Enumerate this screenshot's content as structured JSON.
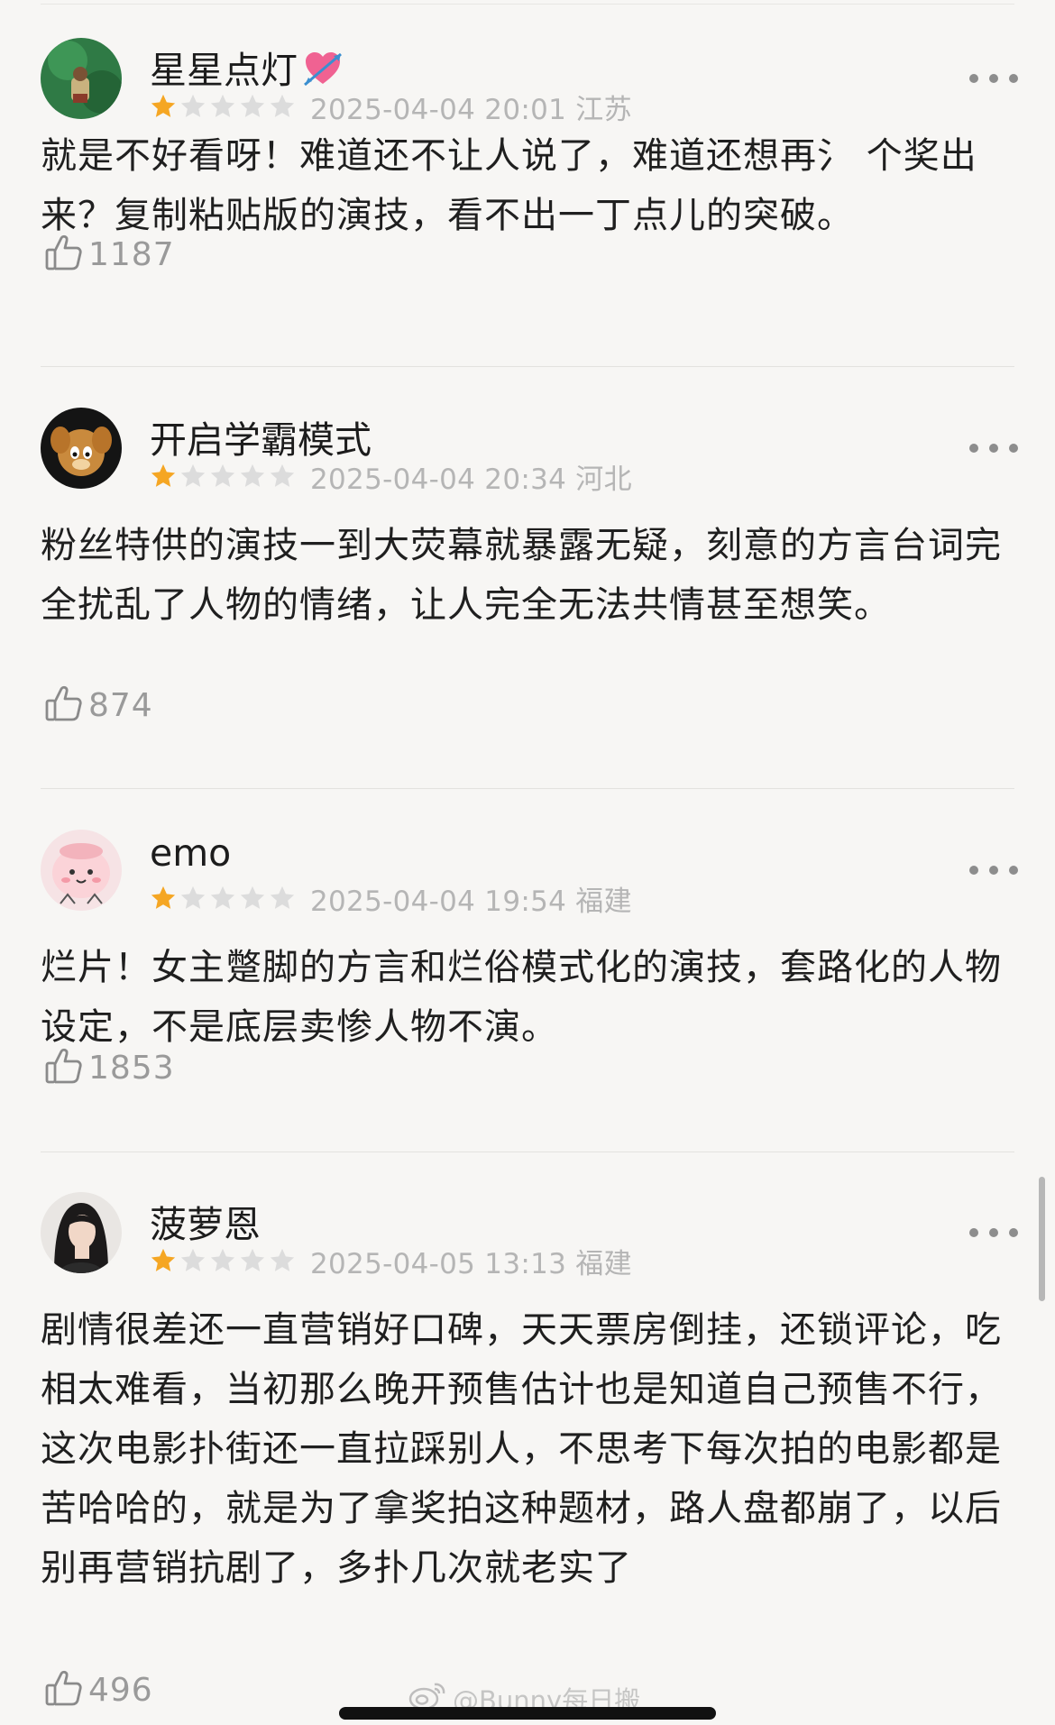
{
  "comments": [
    {
      "username": "星星点灯",
      "has_emoji": true,
      "emoji_name": "heart-with-arrow",
      "rating": 1,
      "max_rating": 5,
      "meta": "2025-04-04 20:01 江苏",
      "text": "就是不好看呀！难道还不让人说了，难道还想再氵 个奖出来？复制粘贴版的演技，看不出一丁点儿的突破。",
      "likes": "1187"
    },
    {
      "username": "开启学霸模式",
      "rating": 1,
      "max_rating": 5,
      "meta": "2025-04-04 20:34 河北",
      "text": "粉丝特供的演技一到大荧幕就暴露无疑，刻意的方言台词完全扰乱了人物的情绪，让人完全无法共情甚至想笑。",
      "likes": "874"
    },
    {
      "username": "emo",
      "rating": 1,
      "max_rating": 5,
      "meta": "2025-04-04 19:54 福建",
      "text": "烂片！女主蹩脚的方言和烂俗模式化的演技，套路化的人物设定，不是底层卖惨人物不演。",
      "likes": "1853"
    },
    {
      "username": "菠萝恩",
      "rating": 1,
      "max_rating": 5,
      "meta": "2025-04-05 13:13 福建",
      "text": "剧情很差还一直营销好口碑，天天票房倒挂，还锁评论，吃相太难看，当初那么晚开预售估计也是知道自己预售不行，这次电影扑街还一直拉踩别人，不思考下每次拍的电影都是苦哈哈的，就是为了拿奖拍这种题材，路人盘都崩了，以后别再营销抗剧了，多扑几次就老实了",
      "likes": "496"
    }
  ],
  "watermark": "@Bunny每日搬",
  "colors": {
    "background": "#f7f6f4",
    "star_filled": "#f5a623",
    "star_empty": "#dcdcdc",
    "meta_text": "#b5b5b5",
    "like_text": "#9a9a9a"
  },
  "icons": {
    "like": "thumbs-up-icon",
    "more": "more-dots-icon",
    "watermark": "weibo-logo-icon"
  }
}
